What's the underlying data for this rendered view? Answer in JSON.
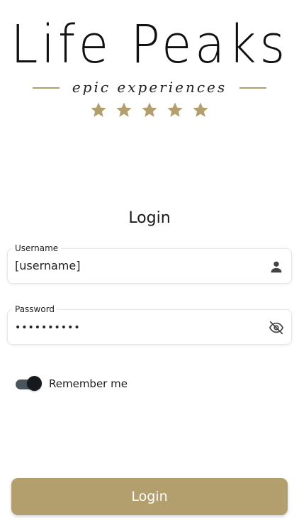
{
  "brand": {
    "title": "Life Peaks",
    "tagline": "epic experiences",
    "star_count": 5,
    "accent_color": "#b39e6d"
  },
  "form": {
    "heading": "Login",
    "username": {
      "label": "Username",
      "value": "[username]",
      "icon": "person-icon"
    },
    "password": {
      "label": "Password",
      "value": "••••••••••",
      "icon": "eye-off-icon"
    },
    "remember": {
      "label": "Remember me",
      "enabled": true
    },
    "submit_label": "Login"
  }
}
